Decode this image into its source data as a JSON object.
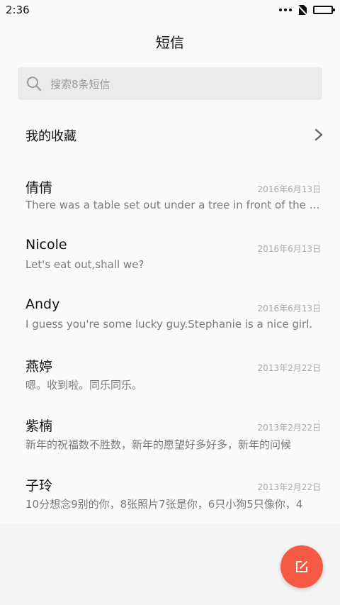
{
  "status_bar": {
    "time": "2:36",
    "battery_color": "#22c55e"
  },
  "header": {
    "title": "短信"
  },
  "search": {
    "placeholder": "搜索8条短信"
  },
  "favorites": {
    "label": "我的收藏"
  },
  "conversations": [
    {
      "name": "倩倩",
      "date": "2016年6月13日",
      "preview": "There was a table set out under a tree in front of the house"
    },
    {
      "name": "Nicole",
      "date": "2016年6月13日",
      "preview": "Let's eat out,shall we?"
    },
    {
      "name": "Andy",
      "date": "2016年6月13日",
      "preview": "I guess you're some lucky guy.Stephanie is a nice girl."
    },
    {
      "name": "燕婷",
      "date": "2013年2月22日",
      "preview": "嗯。收到啦。同乐同乐。"
    },
    {
      "name": "紫楠",
      "date": "2013年2月22日",
      "preview": "新年的祝福数不胜数，新年的愿望好多好多，新年的问候"
    },
    {
      "name": "子玲",
      "date": "2013年2月22日",
      "preview": "10分想念9别的你，8张照片7张是你，6只小狗5只像你，4"
    }
  ],
  "fab": {
    "icon": "compose-icon",
    "color": "#f55a47"
  }
}
